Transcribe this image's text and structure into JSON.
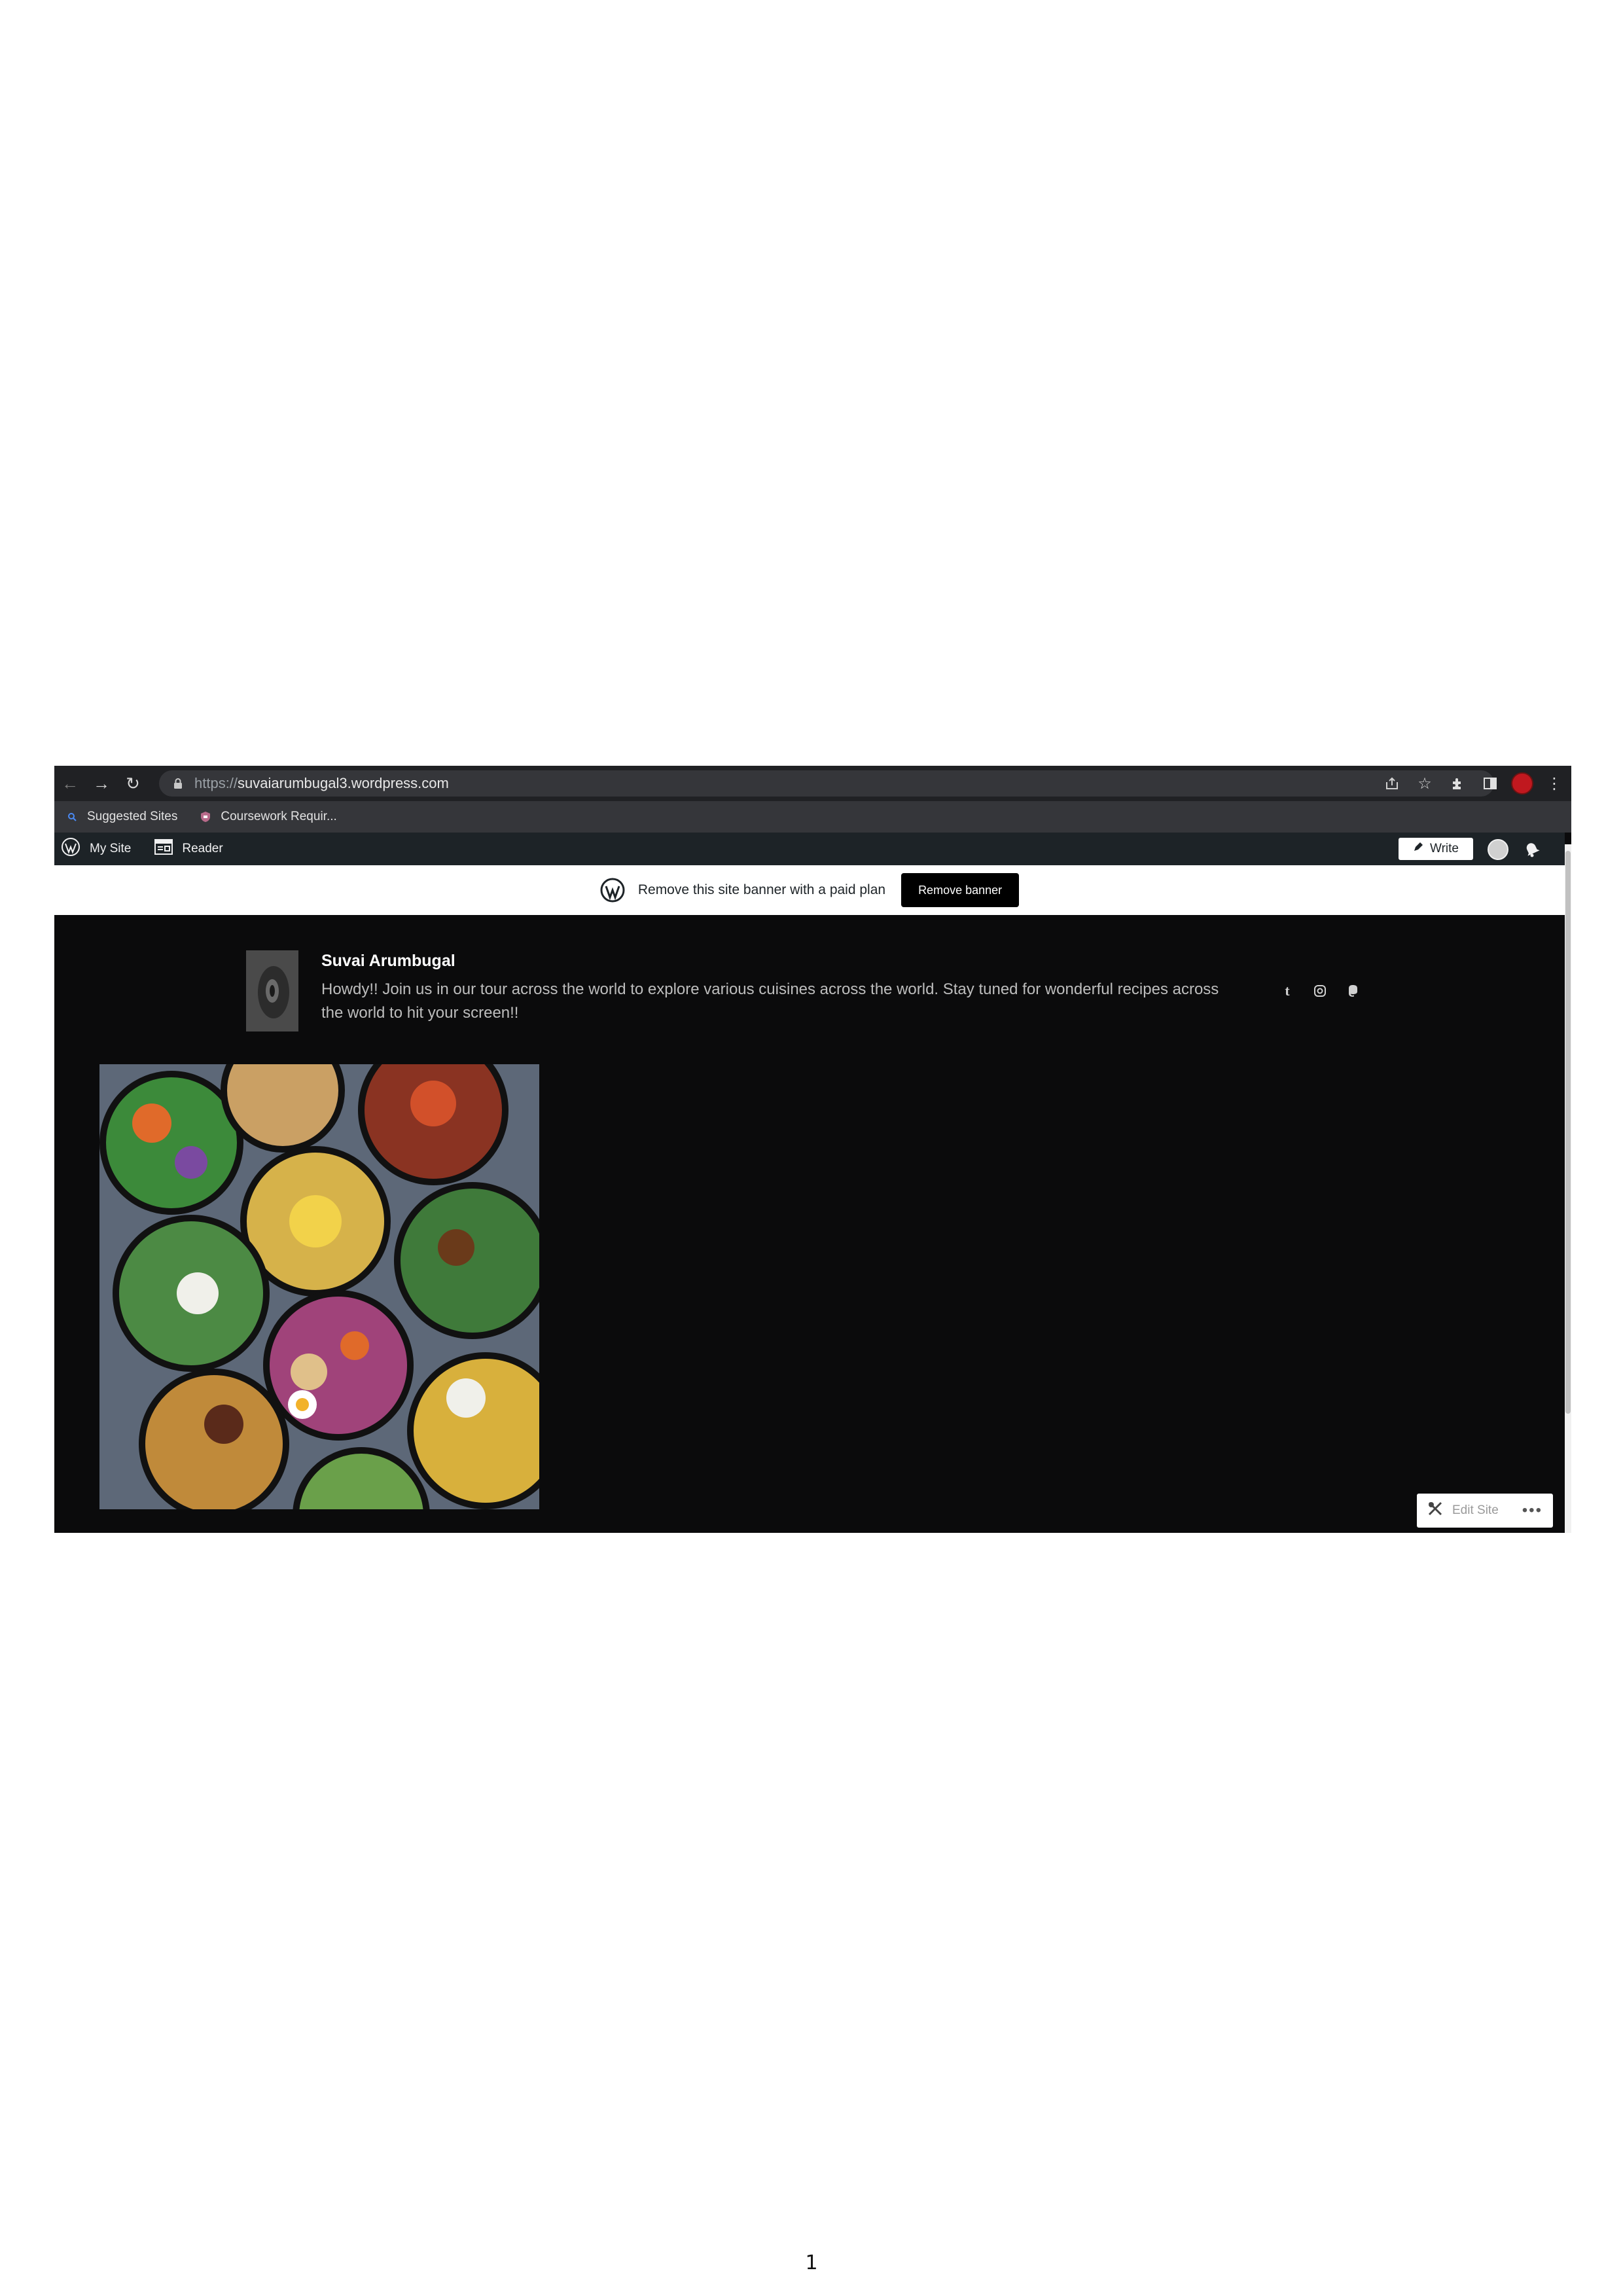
{
  "browser": {
    "url_scheme": "https://",
    "url_host": "suvaiarumbugal3.wordpress.com",
    "bookmarks": [
      "Suggested Sites",
      "Coursework Requir..."
    ]
  },
  "wp_admin_bar": {
    "my_site": "My Site",
    "reader": "Reader",
    "write": "Write"
  },
  "banner": {
    "text": "Remove this site banner with a paid plan",
    "button": "Remove banner"
  },
  "site": {
    "title": "Suvai Arumbugal",
    "description": "Howdy!! Join us in our tour across the world to explore various cuisines across the world. Stay tuned for wonderful recipes across the world to hit your screen!!",
    "social": [
      "tumblr-icon",
      "instagram-icon",
      "mastodon-icon"
    ]
  },
  "edit_site": {
    "label": "Edit Site",
    "more": "•••"
  },
  "page_number": "1",
  "colors": {
    "page_bg": "#0b0b0c",
    "chrome_bg": "#202124",
    "admin_bar": "#1d2327"
  }
}
